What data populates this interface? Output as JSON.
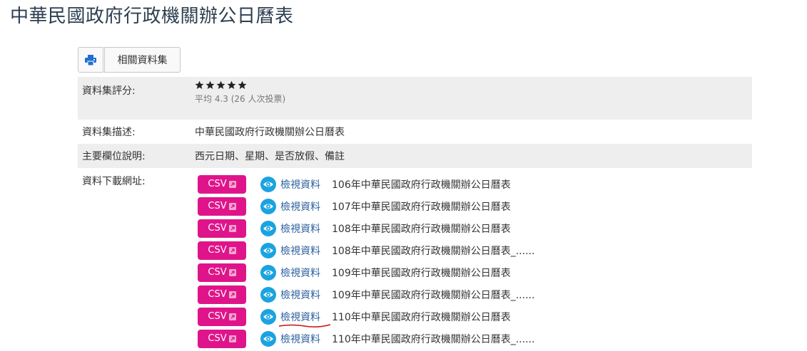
{
  "page": {
    "title": "中華民國政府行政機關辦公日曆表"
  },
  "toolbar": {
    "print_icon": "printer-icon",
    "related_label": "相關資料集"
  },
  "rating": {
    "label": "資料集評分:",
    "stars": 5,
    "summary": "平均 4.3 (26 人次投票)"
  },
  "description": {
    "label": "資料集描述:",
    "value": "中華民國政府行政機關辦公日曆表"
  },
  "fields": {
    "label": "主要欄位說明:",
    "value": "西元日期、星期、是否放假、備註"
  },
  "downloads": {
    "label": "資料下載網址:",
    "items": [
      {
        "format": "CSV",
        "view": "檢視資料",
        "name": "106年中華民國政府行政機關辦公日曆表"
      },
      {
        "format": "CSV",
        "view": "檢視資料",
        "name": "107年中華民國政府行政機關辦公日曆表"
      },
      {
        "format": "CSV",
        "view": "檢視資料",
        "name": "108年中華民國政府行政機關辦公日曆表"
      },
      {
        "format": "CSV",
        "view": "檢視資料",
        "name": "108年中華民國政府行政機關辦公日曆表_......"
      },
      {
        "format": "CSV",
        "view": "檢視資料",
        "name": "109年中華民國政府行政機關辦公日曆表"
      },
      {
        "format": "CSV",
        "view": "檢視資料",
        "name": "109年中華民國政府行政機關辦公日曆表_......"
      },
      {
        "format": "CSV",
        "view": "檢視資料",
        "name": "110年中華民國政府行政機關辦公日曆表"
      },
      {
        "format": "CSV",
        "view": "檢視資料",
        "name": "110年中華民國政府行政機關辦公日曆表_......"
      }
    ]
  },
  "colors": {
    "csv_button": "#e0148a",
    "eye_icon": "#1aa3e0",
    "link": "#2a5f9e",
    "star": "#222222",
    "print_icon": "#1f6fd1",
    "annotation": "#cc1111"
  }
}
